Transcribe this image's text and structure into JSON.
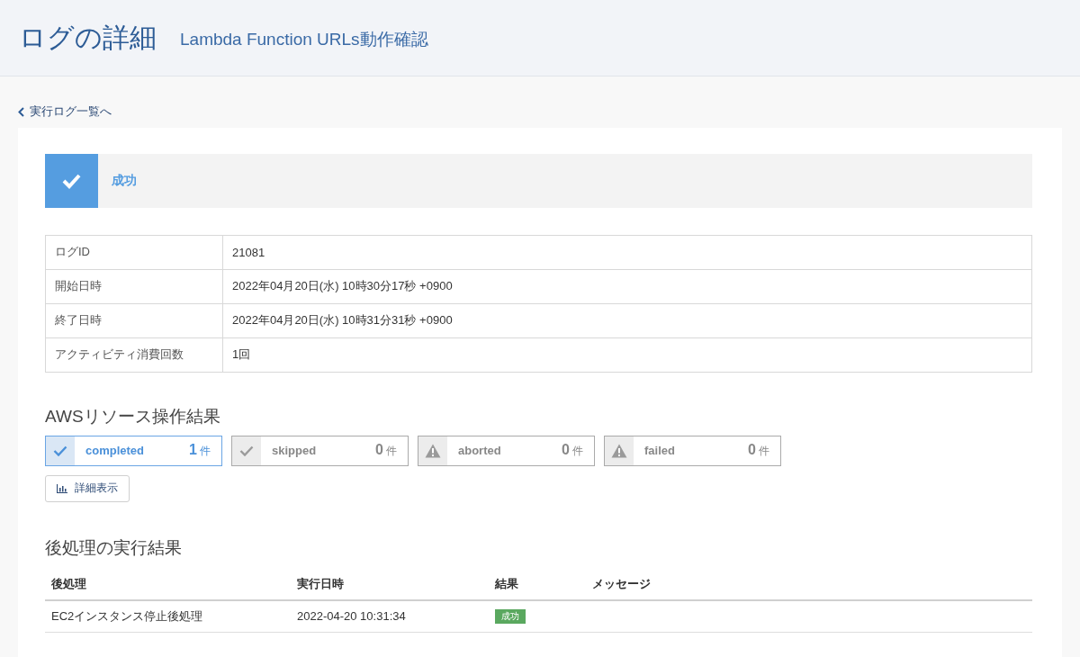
{
  "header": {
    "title": "ログの詳細",
    "subtitle": "Lambda Function URLs動作確認"
  },
  "back_link": {
    "label": "実行ログ一覧へ"
  },
  "status": {
    "kind": "success",
    "label": "成功"
  },
  "details": [
    {
      "label": "ログID",
      "value": "21081"
    },
    {
      "label": "開始日時",
      "value": "2022年04月20日(水) 10時30分17秒 +0900"
    },
    {
      "label": "終了日時",
      "value": "2022年04月20日(水) 10時31分31秒 +0900"
    },
    {
      "label": "アクティビティ消費回数",
      "value": "1回"
    }
  ],
  "resource_results": {
    "heading": "AWSリソース操作結果",
    "counters": [
      {
        "kind": "check",
        "label": "completed",
        "count": "1",
        "unit": "件",
        "selected": true
      },
      {
        "kind": "check",
        "label": "skipped",
        "count": "0",
        "unit": "件",
        "selected": false
      },
      {
        "kind": "warning",
        "label": "aborted",
        "count": "0",
        "unit": "件",
        "selected": false
      },
      {
        "kind": "warning",
        "label": "failed",
        "count": "0",
        "unit": "件",
        "selected": false
      }
    ],
    "detail_button": "詳細表示"
  },
  "post_processing": {
    "heading": "後処理の実行結果",
    "columns": [
      "後処理",
      "実行日時",
      "結果",
      "メッセージ"
    ],
    "rows": [
      {
        "name": "EC2インスタンス停止後処理",
        "executed_at": "2022-04-20 10:31:34",
        "result": {
          "kind": "success",
          "label": "成功"
        }
      }
    ]
  }
}
